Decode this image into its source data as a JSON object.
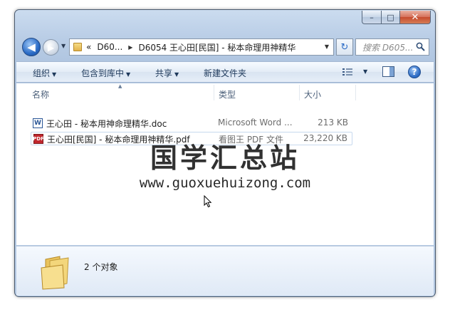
{
  "window": {
    "caption_minimize": "–",
    "caption_maximize": "□",
    "caption_close": "✕"
  },
  "nav": {
    "back_glyph": "◀",
    "forward_glyph": "▶",
    "history_glyph": "▼"
  },
  "address": {
    "overflow": "«",
    "crumbs": [
      "D60...",
      "D6054 王心田[民国] - 秘本命理用神精华"
    ],
    "separator": "▶",
    "dropdown": "▼"
  },
  "refresh_glyph": "↻",
  "search": {
    "placeholder": "搜索 D605..."
  },
  "toolbar": {
    "organize": "组织",
    "include_in_library": "包含到库中",
    "share": "共享",
    "new_folder": "新建文件夹",
    "arrow": "▼",
    "help": "?"
  },
  "columns": {
    "name": "名称",
    "type": "类型",
    "size": "大小",
    "sort_glyph": "▲"
  },
  "files": [
    {
      "icon": "W",
      "name": "王心田 - 秘本用神命理精华.doc",
      "type": "Microsoft Word ...",
      "size": "213 KB"
    },
    {
      "icon": "PDF",
      "name": "王心田[民国] - 秘本命理用神精华.pdf",
      "type": "看图王 PDF 文件",
      "size": "23,220 KB"
    }
  ],
  "watermark": {
    "title": "国学汇总站",
    "url": "www.guoxuehuizong.com"
  },
  "details": {
    "count": "2 个对象"
  },
  "colors": {
    "accent": "#2a6bc6",
    "window_frame": "#b9cde6",
    "pdf_red": "#c1272d"
  }
}
